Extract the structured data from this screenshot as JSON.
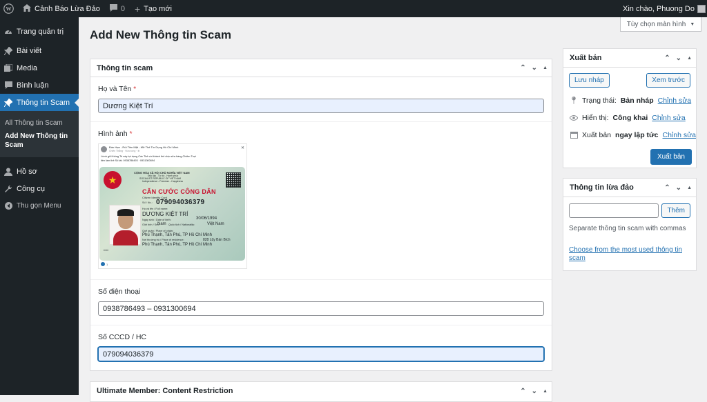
{
  "adminbar": {
    "site_name": "Cảnh Báo Lừa Đảo",
    "comments_count": "0",
    "new_label": "Tạo mới",
    "greeting": "Xin chào, Phuong Do"
  },
  "sidebar": {
    "items": [
      {
        "label": "Trang quản trị",
        "icon": "dashboard-icon"
      },
      {
        "label": "Bài viết",
        "icon": "pin-icon"
      },
      {
        "label": "Media",
        "icon": "media-icon"
      },
      {
        "label": "Bình luận",
        "icon": "comment-icon"
      },
      {
        "label": "Thông tin Scam",
        "icon": "pin-icon"
      }
    ],
    "submenu": [
      "All Thông tin Scam",
      "Add New Thông tin Scam"
    ],
    "bottom": [
      {
        "label": "Hồ sơ",
        "icon": "user-icon"
      },
      {
        "label": "Công cụ",
        "icon": "wrench-icon"
      },
      {
        "label": "Thu gọn Menu",
        "icon": "collapse-icon"
      }
    ]
  },
  "header": {
    "title": "Add New Thông tin Scam",
    "screen_options": "Tùy chọn màn hình"
  },
  "scam_box": {
    "title": "Thông tin scam",
    "name_label": "Họ và Tên",
    "name_value": "Dương Kiệt Trí",
    "image_label": "Hình ảnh",
    "phone_label": "Số điện thoại",
    "phone_value": "0938786493 – 0931300694",
    "id_label": "Số CCCD / HC",
    "id_value": "079094036379",
    "required_mark": "*"
  },
  "card": {
    "post_header": "Đáo Hạn - Rút Tiền Mặt - Mở Thẻ Tín Dụng Hồ Chí Minh",
    "post_sub": "Chiến Thắng · Vừa xong · ⊕",
    "caption_1": "Lừnh gửi thông Tri này lợi dụng Các Thẻ với khách thẻ chịu sửa hàng Chiêm Tuọi",
    "caption_2": "tiền làm thẻ Số tài: 0938786493 · 0931300694",
    "country": "CỘNG HÒA XÃ HỘI CHỦ NGHĨA VIỆT NAM",
    "country_2": "Độc lập - Tự do - Hạnh phúc",
    "country_en": "SOCIALIST REPUBLIC OF VIET NAM",
    "country_en_2": "Independence - Freedom - Happiness",
    "card_title": "CĂN CƯỚC CÔNG DÂN",
    "card_title_en": "Citizen Identity Card",
    "label_no": "Số / No.:",
    "number": "079094036379",
    "label_name": "Họ và tên / Full name:",
    "name": "DƯƠNG KIỆT TRÍ",
    "label_dob": "Ngày sinh / Date of birth:",
    "dob": "30/06/1994",
    "label_sex": "Giới tính / Sex:",
    "sex": "Nam",
    "label_nationality": "Quốc tịch / Nationality:",
    "nationality": "Việt Nam",
    "label_origin": "Quê quán / Place of origin:",
    "origin": "Phú Thạnh, Tân Phú, TP Hồ Chí Minh",
    "label_residence": "Nơi thường trú / Place of residence:",
    "residence_1": "828 Lũy Bán Bích",
    "residence_2": "Phú Thạnh, Tân Phú, TP Hồ Chí Minh",
    "reaction_count": "1"
  },
  "publish": {
    "title": "Xuất bản",
    "save_draft": "Lưu nháp",
    "preview": "Xem trước",
    "status_label": "Trạng thái:",
    "status_value": "Bản nháp",
    "visibility_label": "Hiển thị:",
    "visibility_value": "Công khai",
    "publish_label": "Xuất bản",
    "publish_value": "ngay lập tức",
    "edit_link": "Chỉnh sửa",
    "publish_button": "Xuất bản"
  },
  "tags": {
    "title": "Thông tin lừa đảo",
    "add_button": "Thêm",
    "help": "Separate thông tin scam with commas",
    "choose_link": "Choose from the most used thông tin scam"
  },
  "um_box": {
    "title": "Ultimate Member: Content Restriction"
  },
  "colors": {
    "admin_dark": "#1d2327",
    "accent": "#2271b1",
    "required": "#d63638"
  }
}
